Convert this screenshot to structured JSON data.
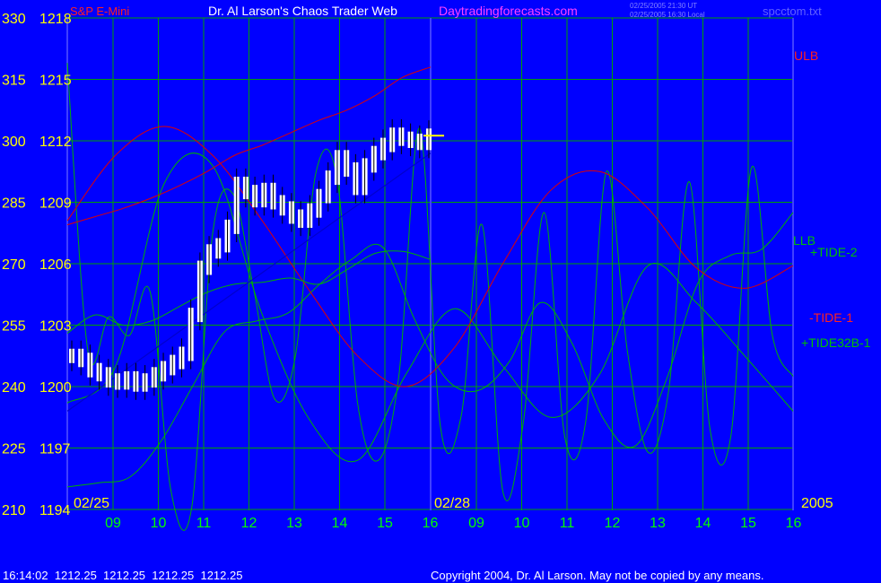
{
  "header": {
    "instrument": "S&P E-Mini",
    "title": "Dr. Al Larson's Chaos Trader Web",
    "site": "Daytradingforecasts.com",
    "time_ut": "02/25/2005 21:30 UT",
    "time_local": "02/25/2005 16:30 Local",
    "file": "spcctom.txt"
  },
  "footer": {
    "quote": "16:14:02  1212.25  1212.25  1212.25  1212.25",
    "copyright": "Copyright 2004, Dr. Al Larson. May not be copied by any means."
  },
  "colors": {
    "background": "#0000ff",
    "grid": "#00a000",
    "price_axis": "#ffff00",
    "header_red": "#ff2020",
    "header_magenta": "#ff40ff",
    "date_axis": "#00ff00",
    "bars": "#ffffff",
    "red_line": "#e00000",
    "green_line": "#00b000",
    "trend_line": "#0000cc",
    "separator": "#4040ff"
  },
  "chart_data": {
    "type": "line",
    "y_left_ticks": [
      "330",
      "315",
      "300",
      "285",
      "270",
      "255",
      "240",
      "225",
      "210"
    ],
    "y_right_ticks": [
      "1218",
      "1215",
      "1212",
      "1209",
      "1206",
      "1203",
      "1200",
      "1197",
      "1194"
    ],
    "ylim": [
      1194,
      1218
    ],
    "x_ticks": [
      "09",
      "10",
      "11",
      "12",
      "13",
      "14",
      "15",
      "16",
      "09",
      "10",
      "11",
      "12",
      "13",
      "14",
      "15",
      "16"
    ],
    "date_labels": [
      "02/25",
      "02/28",
      "2005"
    ],
    "series_labels": {
      "ulb": "ULB",
      "llb": "LLB",
      "tide2": "+TIDE-2",
      "tide1": "-TIDE-1",
      "tide32b": "+TIDE32B-1"
    },
    "last_price": 1212.25,
    "price_bars_close": [
      1201.5,
      1201.3,
      1200.8,
      1200.6,
      1200.3,
      1200.2,
      1200.4,
      1200.1,
      1200.3,
      1200.6,
      1200.9,
      1201.2,
      1201.6,
      1203.5,
      1205.8,
      1206.6,
      1206.9,
      1207.8,
      1209.9,
      1209.5,
      1209.1,
      1209.6,
      1209.0,
      1208.7,
      1208.3,
      1208.1,
      1208.6,
      1209.3,
      1210.2,
      1211.2,
      1210.6,
      1209.7,
      1210.8,
      1211.4,
      1211.8,
      1212.3,
      1212.1,
      1212.0,
      1211.9,
      1212.25
    ],
    "ulb": [
      1207.9,
      1208.3,
      1208.7,
      1209.2,
      1209.8,
      1210.5,
      1211.3,
      1211.8,
      1212.4,
      1213.0,
      1213.5,
      1214.2,
      1215.1,
      1215.6
    ],
    "llb": [
      1202.6,
      1203.5,
      1203.0,
      1203.2,
      1203.9,
      1204.6,
      1205.0,
      1205.1,
      1205.3,
      1205.0,
      1205.7,
      1206.5,
      1206.6,
      1206.2
    ],
    "tide1": [
      1208.1,
      1211.3,
      1212.7,
      1211.3,
      1208.2,
      1204.7,
      1201.5,
      1200.0,
      1201.9,
      1206.0,
      1209.6,
      1210.5,
      1208.7,
      1205.8,
      1204.8,
      1205.9
    ],
    "tide2": [
      1199.2,
      1201.0,
      1209.9,
      1210.8,
      1203.7,
      1198.4,
      1196.4,
      1200.6,
      1203.8,
      1201.0,
      1198.5,
      1200.6,
      1205.9,
      1204.1,
      1201.5,
      1198.8
    ],
    "tide32b": [
      1195.1,
      1195.3,
      1195.6,
      1197.4,
      1200.1,
      1202.7,
      1203.2,
      1203.6,
      1205.0,
      1206.2,
      1206.8,
      1203.3,
      1200.4,
      1199.8,
      1201.2,
      1204.1,
      1202.1,
      1198.4,
      1197.1,
      1200.4,
      1205.1,
      1206.4,
      1206.7,
      1208.5
    ],
    "tide_fast": [
      1215.8,
      1201.7,
      1203.4,
      1202.5,
      1204.6,
      1194.9,
      1194.1,
      1207.4,
      1209.4,
      1204.7,
      1199.4,
      1201.5,
      1210.5,
      1210.2,
      1199.2,
      1196.4,
      1200.6,
      1212.6,
      1198.0,
      1198.6,
      1207.9,
      1194.9,
      1198.3,
      1208.5,
      1197.5,
      1198.3,
      1210.5,
      1201.8,
      1196.8,
      1199.8,
      1210.0,
      1197.9,
      1197.6,
      1210.7,
      1202.5,
      1200.5
    ]
  }
}
